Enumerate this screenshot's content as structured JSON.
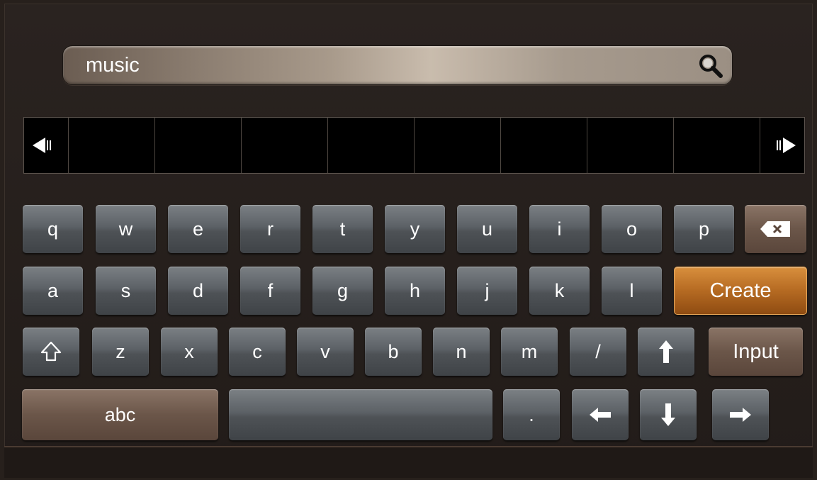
{
  "search": {
    "value": "music",
    "icon": "search-icon"
  },
  "candidate_bar": {
    "prev_icon": "prev-page-icon",
    "next_icon": "next-page-icon",
    "cells": [
      "",
      "",
      "",
      "",
      "",
      "",
      "",
      ""
    ]
  },
  "keyboard": {
    "row1": [
      "q",
      "w",
      "e",
      "r",
      "t",
      "y",
      "u",
      "i",
      "o",
      "p"
    ],
    "row2": [
      "a",
      "s",
      "d",
      "f",
      "g",
      "h",
      "j",
      "k",
      "l"
    ],
    "row3": [
      "z",
      "x",
      "c",
      "v",
      "b",
      "n",
      "m",
      "/"
    ],
    "create_label": "Create",
    "input_label": "Input",
    "abc_label": "abc",
    "period_label": ".",
    "icons": {
      "backspace": "backspace-icon",
      "shift": "shift-icon",
      "up": "arrow-up-icon",
      "left": "arrow-left-icon",
      "down": "arrow-down-icon",
      "right": "arrow-right-icon"
    }
  }
}
